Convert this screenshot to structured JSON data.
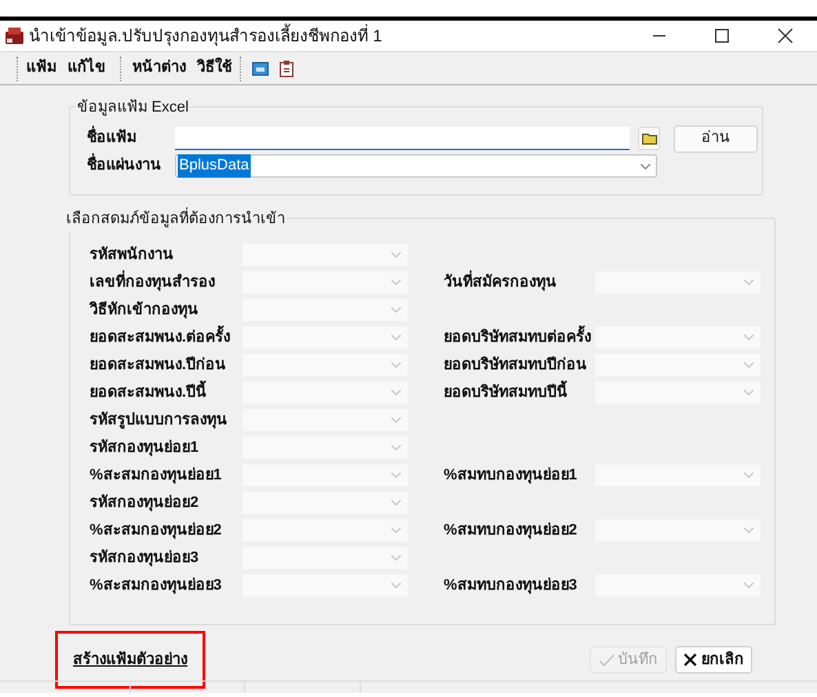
{
  "window": {
    "title": "นำเข้าข้อมูล.ปรับปรุงกองทุนสำรองเลี้ยงชีพกองที่ 1"
  },
  "menu": [
    "แฟ้ม",
    "แก้ไข",
    "หน้าต่าง",
    "วิธีใช้"
  ],
  "excel_group": {
    "title": "ข้อมูลแฟ้ม Excel",
    "file_label": "ชื่อแฟ้ม",
    "read_button": "อ่าน",
    "sheet_label": "ชื่อแผ่นงาน",
    "sheet_value": "BplusData"
  },
  "mapping_group": {
    "title": "เลือกสดมภ์ข้อมูลที่ต้องการนำเข้า",
    "rows": [
      {
        "left": "รหัสพนักงาน"
      },
      {
        "left": "เลขที่กองทุนสำรอง",
        "right": "วันที่สมัครกองทุน"
      },
      {
        "left": "วิธีหักเข้ากองทุน"
      },
      {
        "left": "ยอดสะสมพนง.ต่อครั้ง",
        "right": "ยอดบริษัทสมทบต่อครั้ง"
      },
      {
        "left": "ยอดสะสมพนง.ปีก่อน",
        "right": "ยอดบริษัทสมทบปีก่อน"
      },
      {
        "left": "ยอดสะสมพนง.ปีนี้",
        "right": "ยอดบริษัทสมทบปีนี้"
      },
      {
        "left": "รหัสรูปแบบการลงทุน"
      },
      {
        "left": "รหัสกองทุนย่อย1"
      },
      {
        "left": "%สะสมกองทุนย่อย1",
        "right": "%สมทบกองทุนย่อย1"
      },
      {
        "left": "รหัสกองทุนย่อย2"
      },
      {
        "left": "%สะสมกองทุนย่อย2",
        "right": "%สมทบกองทุนย่อย2"
      },
      {
        "left": "รหัสกองทุนย่อย3"
      },
      {
        "left": "%สะสมกองทุนย่อย3",
        "right": "%สมทบกองทุนย่อย3"
      }
    ]
  },
  "sample_link": {
    "label": "สร้างแฟ้มตัวอย่าง",
    "highlighted": true
  },
  "buttons": [
    {
      "kind": "save",
      "label": "บันทึก",
      "disabled": true
    },
    {
      "kind": "cancel",
      "label": "ยกเลิก",
      "disabled": false
    }
  ]
}
